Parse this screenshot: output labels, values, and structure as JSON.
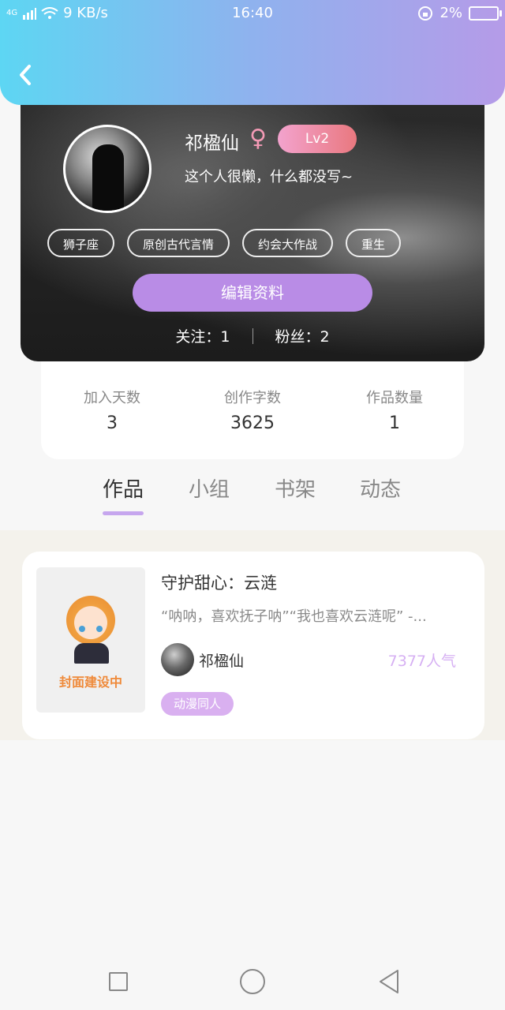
{
  "status_bar": {
    "network": "4G",
    "speed": "9 KB/s",
    "time": "16:40",
    "battery": "2%"
  },
  "header": {
    "back_icon": "chevron-left-icon"
  },
  "profile": {
    "name": "祁楹仙",
    "gender_symbol": "♀",
    "level": "Lv2",
    "bio": "这个人很懒，什么都没写~",
    "tags": [
      "狮子座",
      "原创古代言情",
      "约会大作战",
      "重生"
    ],
    "edit_button": "编辑资料",
    "following": "关注：1",
    "followers": "粉丝：2"
  },
  "stats": [
    {
      "label": "加入天数",
      "value": "3"
    },
    {
      "label": "创作字数",
      "value": "3625"
    },
    {
      "label": "作品数量",
      "value": "1"
    }
  ],
  "tabs": [
    {
      "label": "作品",
      "active": true
    },
    {
      "label": "小组",
      "active": false
    },
    {
      "label": "书架",
      "active": false
    },
    {
      "label": "动态",
      "active": false
    }
  ],
  "work": {
    "cover_text": "封面建设中",
    "title": "守护甜心：云涟",
    "description": "“呐呐，喜欢抚子呐”“我也喜欢云涟呢” -...",
    "author": "祁楹仙",
    "popularity": "7377人气",
    "category": "动漫同人"
  },
  "nav": {
    "square": "recent-apps-icon",
    "circle": "home-icon",
    "triangle": "back-triangle-icon"
  },
  "colors": {
    "accent": "#b98ce6",
    "header_start": "#5dd6f3",
    "header_end": "#b59be8"
  }
}
